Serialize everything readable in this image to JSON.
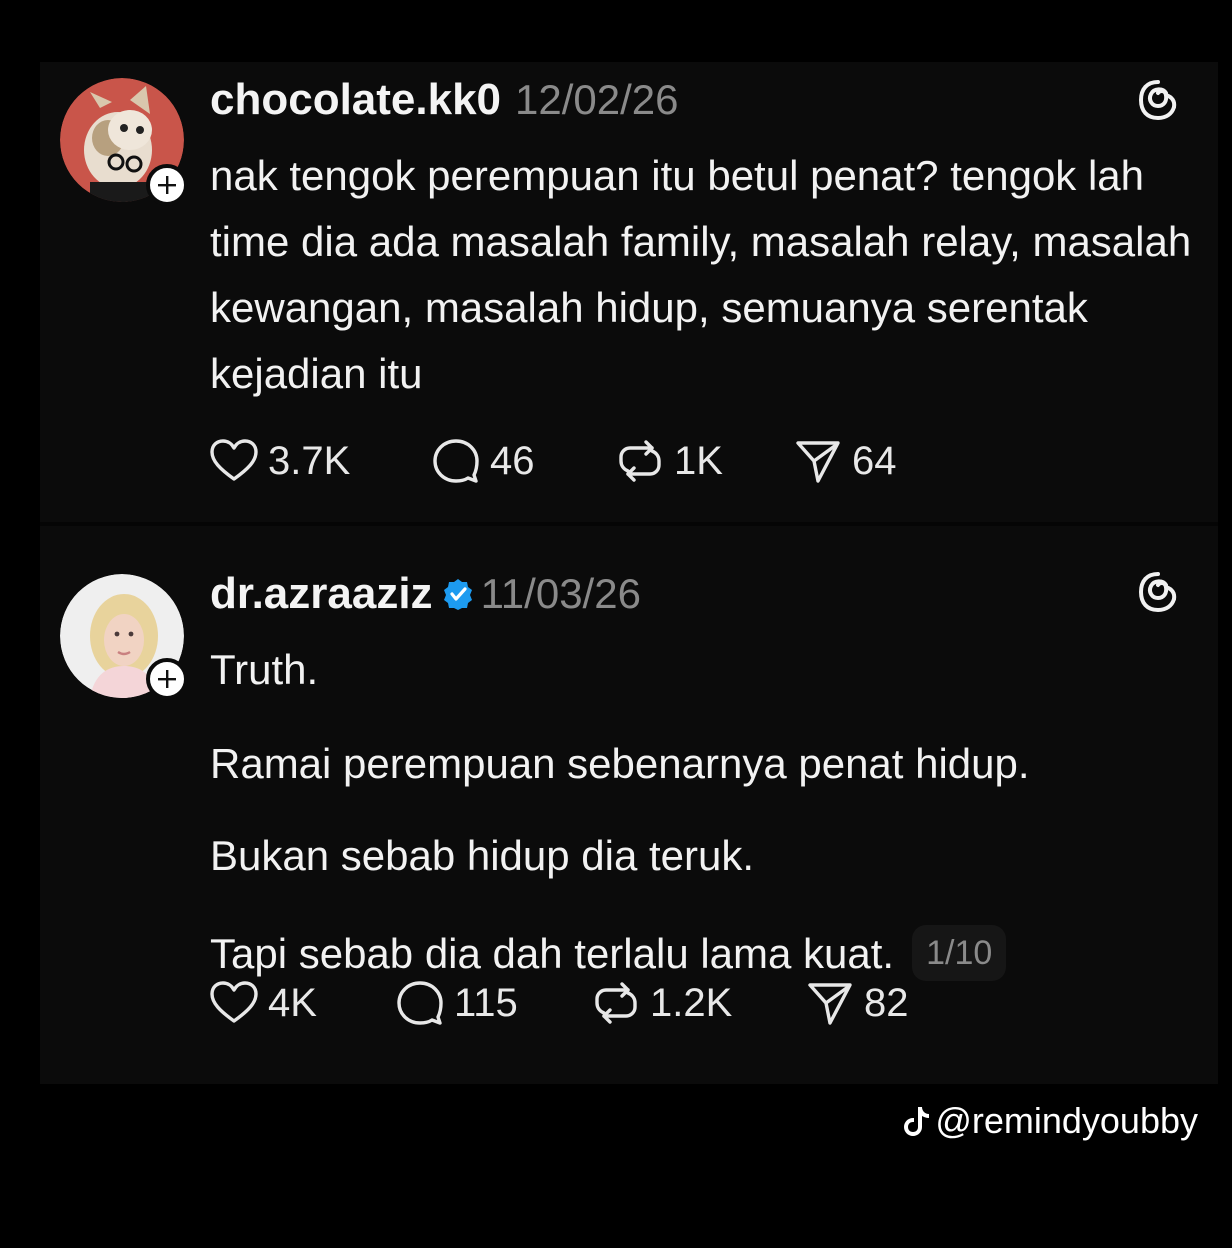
{
  "posts": [
    {
      "username": "chocolate.kk0",
      "verified": false,
      "date": "12/02/26",
      "avatar_icon": "cat-with-glasses-avatar",
      "text": "nak tengok perempuan itu betul penat? tengok lah time dia ada masalah family, masalah relay, masalah kewangan, masalah hidup, semuanya serentak kejadian itu",
      "stats": {
        "likes": "3.7K",
        "replies": "46",
        "reposts": "1K",
        "shares": "64"
      }
    },
    {
      "username": "dr.azraaziz",
      "verified": true,
      "date": "11/03/26",
      "avatar_icon": "woman-in-hijab-avatar",
      "paragraphs": [
        "Truth.",
        "Ramai perempuan sebenarnya penat hidup.",
        "Bukan sebab hidup dia teruk.",
        "Tapi sebab dia dah terlalu lama kuat."
      ],
      "page_counter": "1/10",
      "stats": {
        "likes": "4K",
        "replies": "115",
        "reposts": "1.2K",
        "shares": "82"
      }
    }
  ],
  "watermark": {
    "icon": "tiktok-icon",
    "handle": "@remindyoubby"
  },
  "colors": {
    "background": "#000000",
    "card": "#0b0b0b",
    "text": "#f2f2f2",
    "muted": "#8a8a8a",
    "verified": "#1d9bf0"
  }
}
